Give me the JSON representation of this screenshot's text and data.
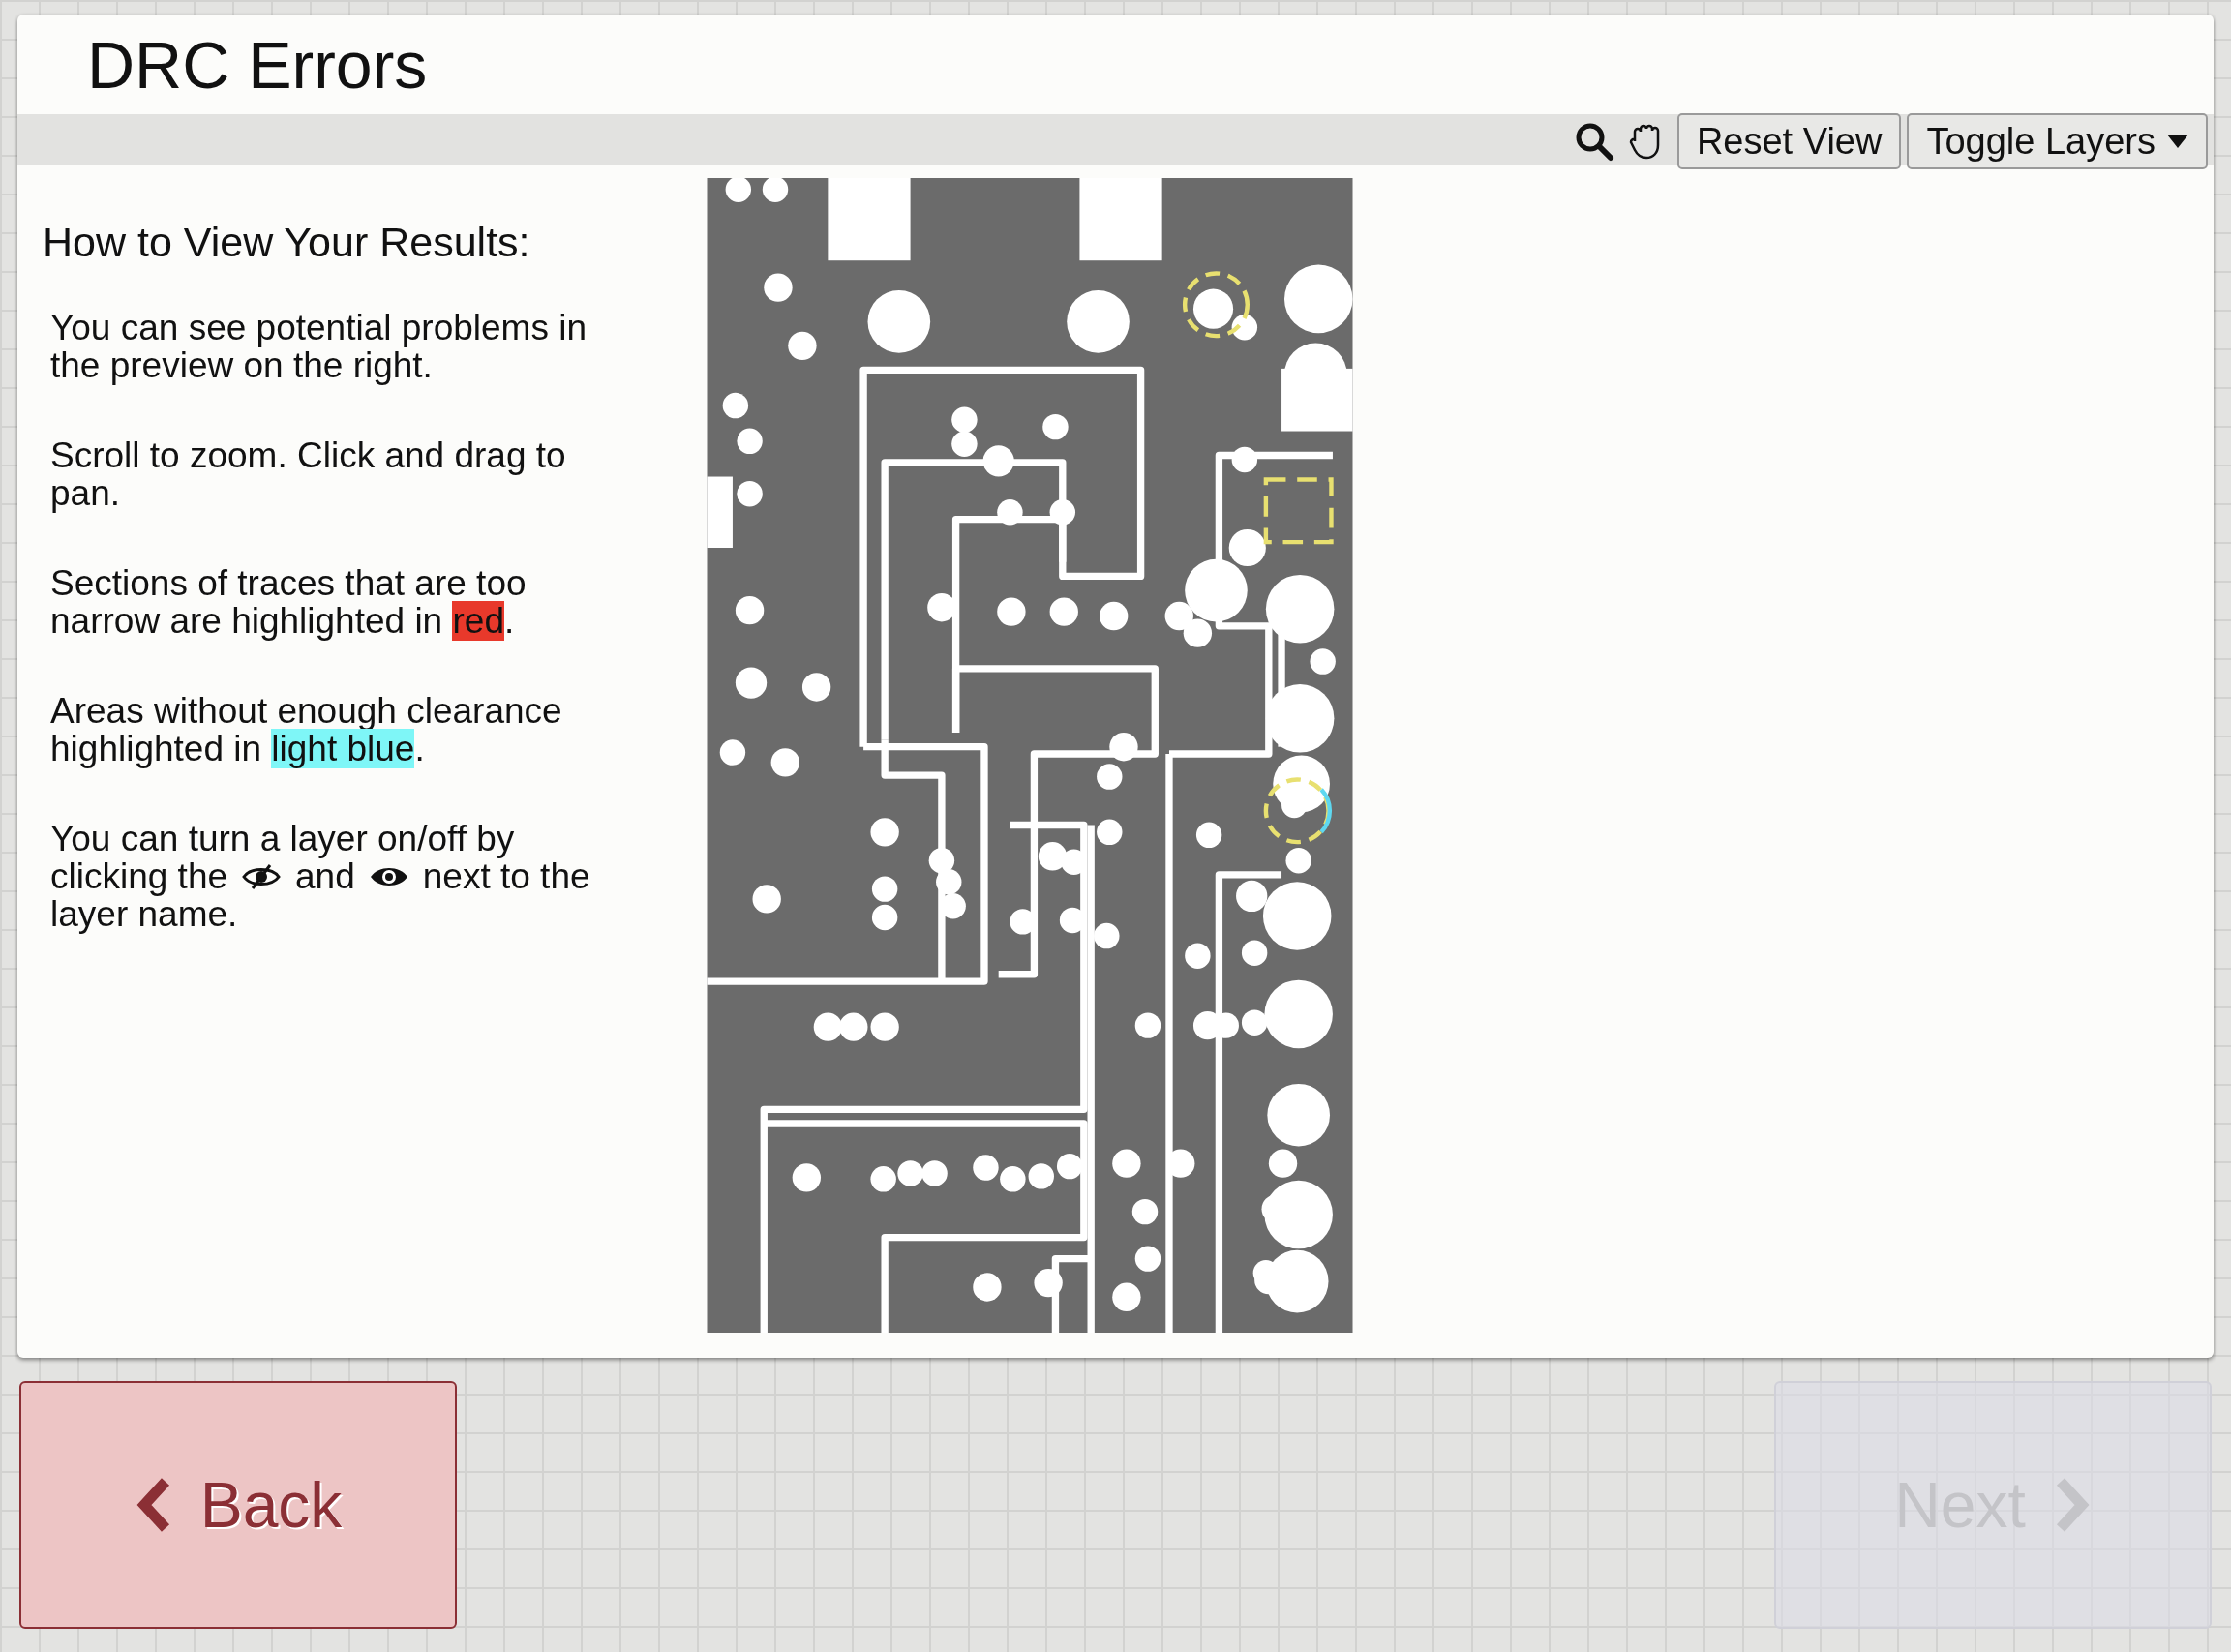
{
  "window": {
    "title": "DRC Errors"
  },
  "toolbar": {
    "buttons": [
      {
        "label": "Reset View",
        "kind": "plain"
      },
      {
        "label": "Toggle Layers",
        "kind": "dropdown"
      }
    ]
  },
  "instructions": {
    "heading": "How to View Your Results:",
    "paragraphs": [
      {
        "parts": [
          {
            "kind": "text",
            "text": "You can see potential problems in the preview on the right."
          }
        ]
      },
      {
        "parts": [
          {
            "kind": "text",
            "text": "Scroll to zoom. Click and drag to pan."
          }
        ]
      },
      {
        "parts": [
          {
            "kind": "text",
            "text": "Sections of traces that are too narrow are highlighted in "
          },
          {
            "kind": "highlight",
            "text": "red",
            "color": "#e8392b"
          },
          {
            "kind": "text",
            "text": "."
          }
        ]
      },
      {
        "parts": [
          {
            "kind": "text",
            "text": "Areas without enough clearance highlighted in "
          },
          {
            "kind": "highlight",
            "text": "light blue",
            "color": "#7ef6f7"
          },
          {
            "kind": "text",
            "text": "."
          }
        ]
      },
      {
        "lines": [
          [
            {
              "kind": "text",
              "text": "You can turn a layer on/off by"
            }
          ],
          [
            {
              "kind": "text",
              "text": "clicking the"
            },
            {
              "kind": "hidden-icon"
            },
            {
              "kind": "text",
              "text": "and"
            },
            {
              "kind": "visible-icon"
            },
            {
              "kind": "text",
              "text": "next to the"
            }
          ],
          [
            {
              "kind": "text",
              "text": "layer name."
            }
          ]
        ]
      }
    ]
  },
  "navigation": [
    {
      "label": "Back",
      "kind": "back",
      "disabled": false
    },
    {
      "label": "Next",
      "kind": "next",
      "disabled": true
    }
  ]
}
